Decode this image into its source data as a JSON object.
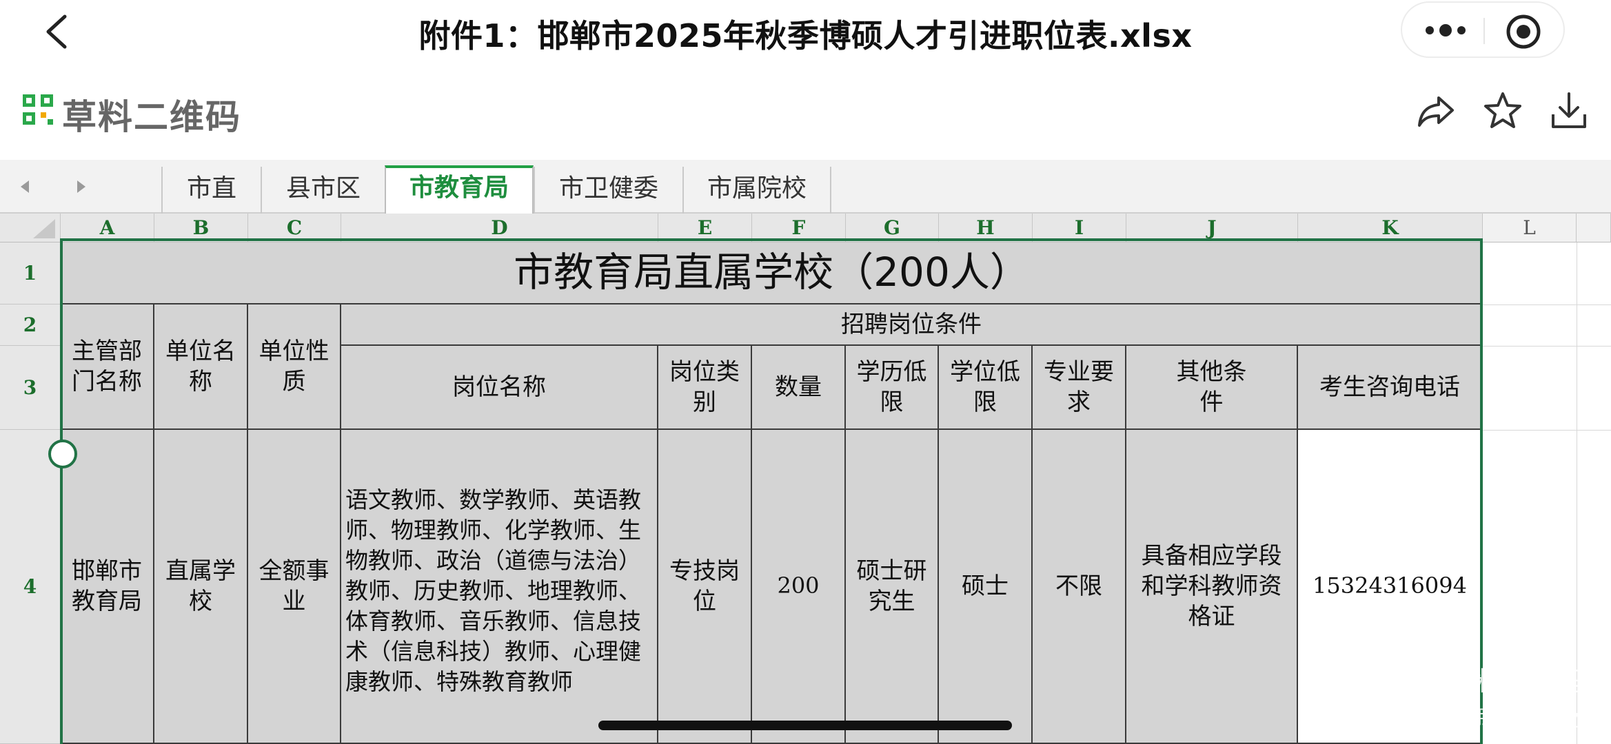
{
  "topbar": {
    "title": "附件1：邯郸市2025年秋季博硕人才引进职位表.xlsx"
  },
  "brand": {
    "name": "草料二维码"
  },
  "tabs": [
    {
      "label": "市直",
      "active": false
    },
    {
      "label": "县市区",
      "active": false
    },
    {
      "label": "市教育局",
      "active": true
    },
    {
      "label": "市卫健委",
      "active": false
    },
    {
      "label": "市属院校",
      "active": false
    }
  ],
  "columns": [
    "A",
    "B",
    "C",
    "D",
    "E",
    "F",
    "G",
    "H",
    "I",
    "J",
    "K",
    "L"
  ],
  "rows": [
    "1",
    "2",
    "3",
    "4"
  ],
  "table": {
    "title": "市教育局直属学校（200人）",
    "group_header": "招聘岗位条件",
    "headers": {
      "dept": "主管部门名称",
      "unit": "单位名称",
      "nature": "单位性质",
      "position": "岗位名称",
      "category": "岗位类别",
      "quantity": "数量",
      "education": "学历低限",
      "degree": "学位低限",
      "major": "专业要求",
      "other": "其他条件",
      "phone": "考生咨询电话"
    },
    "row": {
      "dept": "邯郸市教育局",
      "unit": "直属学校",
      "nature": "全额事业",
      "position": "语文教师、数学教师、英语教师、物理教师、化学教师、生物教师、政治（道德与法治）教师、历史教师、地理教师、体育教师、音乐教师、信息技术（信息科技）教师、心理健康教师、特殊教育教师",
      "category": "专技岗位",
      "quantity": "200",
      "education": "硕士研究生",
      "degree": "硕士",
      "major": "不限",
      "other": "具备相应学段和学科教师资格证",
      "phone": "15324316094"
    }
  },
  "watermark": {
    "brand": "草料二维码",
    "user": "用户 on4hxy"
  },
  "icons": {
    "back": "chevron-left-icon",
    "more": "more-dots-icon",
    "close": "target-close-icon",
    "share": "share-icon",
    "star": "star-icon",
    "download": "download-icon"
  },
  "colors": {
    "accent": "#22a045",
    "selection": "#217346",
    "header_text": "#1c6e2c",
    "cell_fill": "#d4d4d4"
  }
}
